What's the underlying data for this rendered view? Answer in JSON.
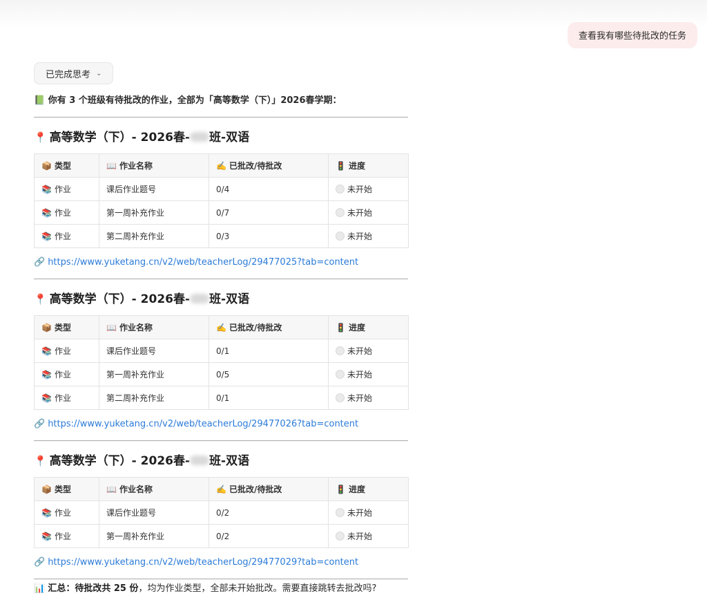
{
  "user_message": "查看我有哪些待批改的任务",
  "thinking_toggle": {
    "label": "已完成思考"
  },
  "intro_text": "你有 3 个班级有待批改的作业，全部为「高等数学（下）」2026春学期：",
  "table_headers": {
    "type": "类型",
    "name": "作业名称",
    "graded": "已批改/待批改",
    "progress": "进度"
  },
  "sections": [
    {
      "title_prefix": "高等数学（下）- 2026春-",
      "title_suffix": "班-双语",
      "rows": [
        {
          "type": "作业",
          "name": "课后作业题号",
          "graded": "0/4",
          "progress": "未开始"
        },
        {
          "type": "作业",
          "name": "第一周补充作业",
          "graded": "0/7",
          "progress": "未开始"
        },
        {
          "type": "作业",
          "name": "第二周补充作业",
          "graded": "0/3",
          "progress": "未开始"
        }
      ],
      "link": "https://www.yuketang.cn/v2/web/teacherLog/29477025?tab=content"
    },
    {
      "title_prefix": "高等数学（下）- 2026春-",
      "title_suffix": "班-双语",
      "rows": [
        {
          "type": "作业",
          "name": "课后作业题号",
          "graded": "0/1",
          "progress": "未开始"
        },
        {
          "type": "作业",
          "name": "第一周补充作业",
          "graded": "0/5",
          "progress": "未开始"
        },
        {
          "type": "作业",
          "name": "第二周补充作业",
          "graded": "0/1",
          "progress": "未开始"
        }
      ],
      "link": "https://www.yuketang.cn/v2/web/teacherLog/29477026?tab=content"
    },
    {
      "title_prefix": "高等数学（下）- 2026春-",
      "title_suffix": "班-双语",
      "rows": [
        {
          "type": "作业",
          "name": "课后作业题号",
          "graded": "0/2",
          "progress": "未开始"
        },
        {
          "type": "作业",
          "name": "第一周补充作业",
          "graded": "0/2",
          "progress": "未开始"
        }
      ],
      "link": "https://www.yuketang.cn/v2/web/teacherLog/29477029?tab=content"
    }
  ],
  "summary": {
    "label": "汇总：",
    "bold": "待批改共 25 份",
    "rest": "，均为作业类型，全部未开始批改。需要直接跳转去批改吗?"
  },
  "icons": [
    "book-icon",
    "pin-icon",
    "package-icon",
    "open-book-icon",
    "writing-hand-icon",
    "traffic-light-icon",
    "books-icon",
    "white-circle-icon",
    "link-icon",
    "bar-chart-icon",
    "chevron-down-icon"
  ]
}
